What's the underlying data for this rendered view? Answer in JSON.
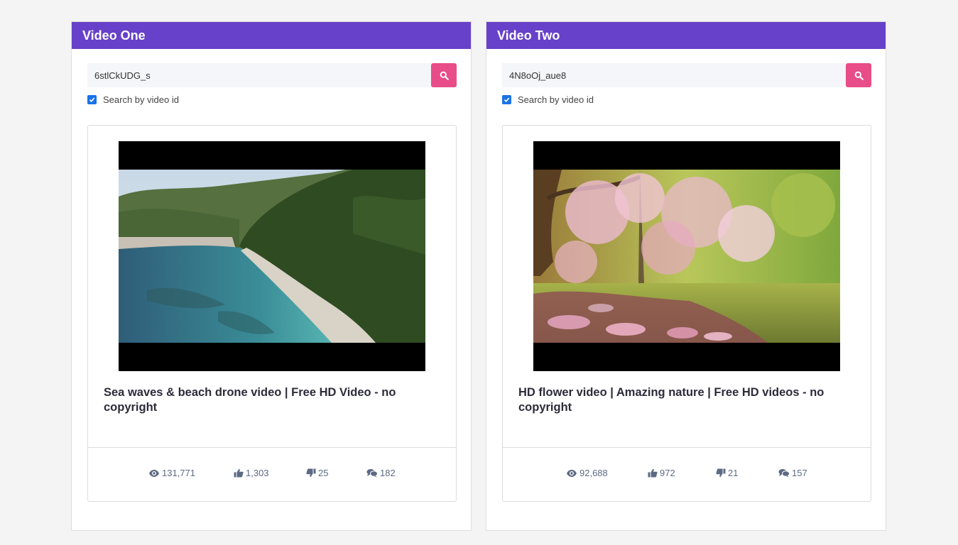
{
  "panels": [
    {
      "header": "Video One",
      "search_value": "6stlCkUDG_s",
      "checkbox_label": "Search by video id",
      "checkbox_checked": true,
      "video_title": "Sea waves & beach drone video | Free HD Video - no copyright",
      "stats": {
        "views": "131,771",
        "likes": "1,303",
        "dislikes": "25",
        "comments": "182"
      }
    },
    {
      "header": "Video Two",
      "search_value": "4N8oOj_aue8",
      "checkbox_label": "Search by video id",
      "checkbox_checked": true,
      "video_title": "HD flower video | Amazing nature | Free HD videos - no copyright",
      "stats": {
        "views": "92,688",
        "likes": "972",
        "dislikes": "21",
        "comments": "157"
      }
    }
  ],
  "icons": {
    "search": "search-icon",
    "views": "eye-icon",
    "likes": "thumbs-up-icon",
    "dislikes": "thumbs-down-icon",
    "comments": "comments-icon"
  },
  "colors": {
    "header": "#6741c9",
    "search_button": "#e84d89",
    "checkbox": "#1a73e8",
    "stat_text": "#5d6a84"
  }
}
